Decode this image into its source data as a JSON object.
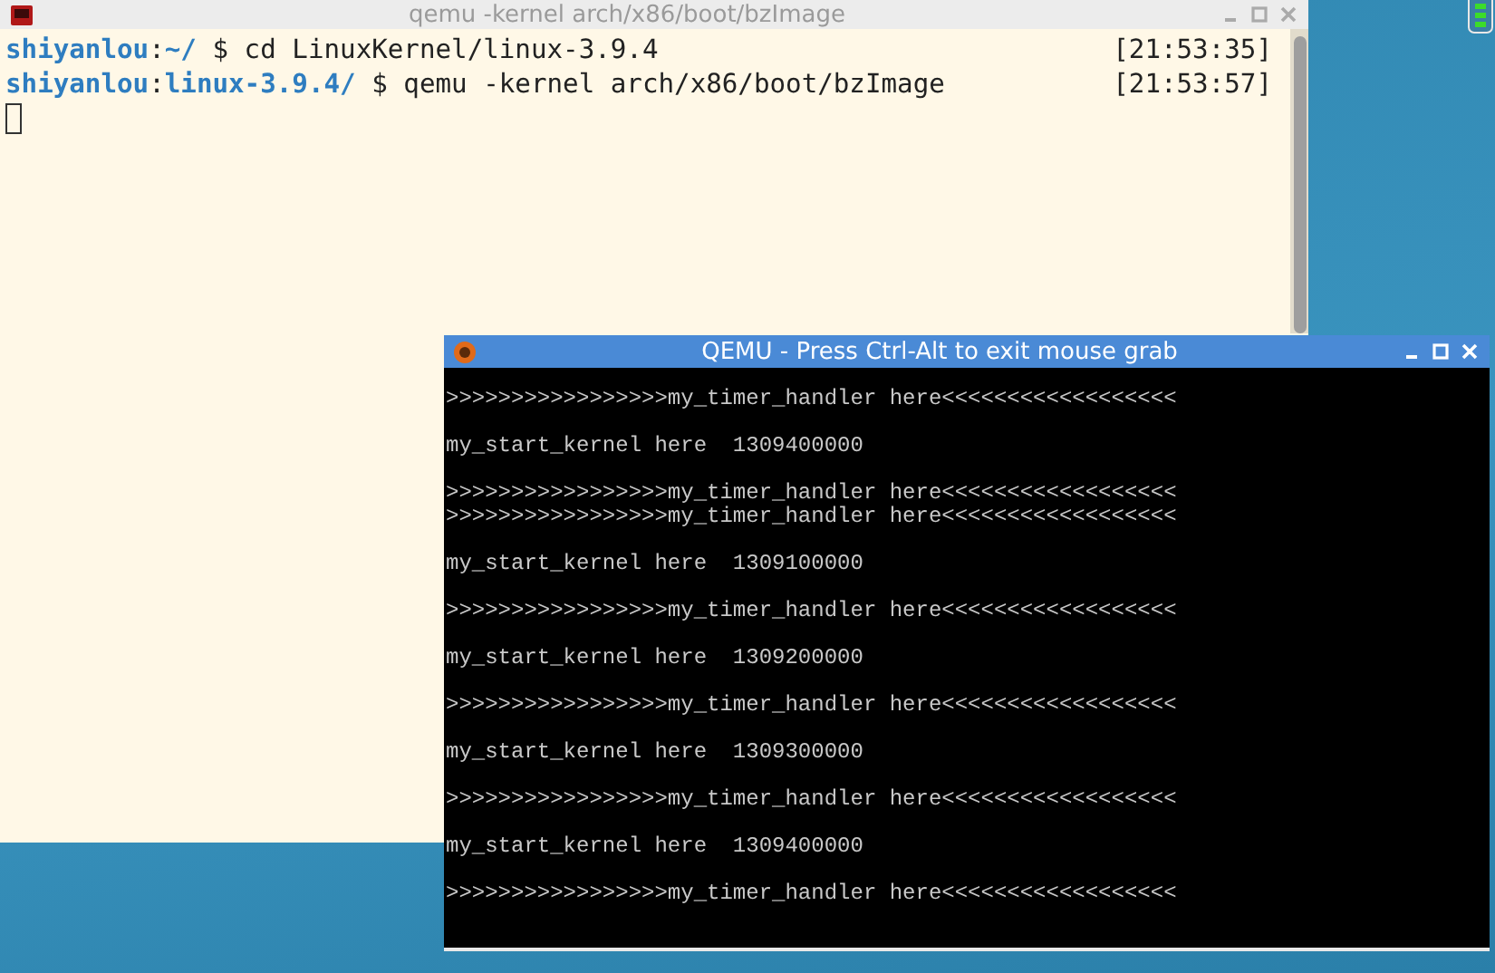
{
  "terminal": {
    "title": "qemu -kernel arch/x86/boot/bzImage",
    "lines": [
      {
        "user": "shiyanlou",
        "separator": ":",
        "path": "~/",
        "command": "$ cd LinuxKernel/linux-3.9.4",
        "time": "[21:53:35]"
      },
      {
        "user": "shiyanlou",
        "separator": ":",
        "path": "linux-3.9.4/",
        "command": "$ qemu -kernel arch/x86/boot/bzImage",
        "time": "[21:53:57]"
      }
    ]
  },
  "qemu": {
    "title": "QEMU - Press Ctrl-Alt to exit mouse grab",
    "blocks": [
      [
        ">>>>>>>>>>>>>>>>>my_timer_handler here<<<<<<<<<<<<<<<<<<"
      ],
      [
        "my_start_kernel here  1309400000"
      ],
      [
        ">>>>>>>>>>>>>>>>>my_timer_handler here<<<<<<<<<<<<<<<<<<",
        ">>>>>>>>>>>>>>>>>my_timer_handler here<<<<<<<<<<<<<<<<<<"
      ],
      [
        "my_start_kernel here  1309100000"
      ],
      [
        ">>>>>>>>>>>>>>>>>my_timer_handler here<<<<<<<<<<<<<<<<<<"
      ],
      [
        "my_start_kernel here  1309200000"
      ],
      [
        ">>>>>>>>>>>>>>>>>my_timer_handler here<<<<<<<<<<<<<<<<<<"
      ],
      [
        "my_start_kernel here  1309300000"
      ],
      [
        ">>>>>>>>>>>>>>>>>my_timer_handler here<<<<<<<<<<<<<<<<<<"
      ],
      [
        "my_start_kernel here  1309400000"
      ],
      [
        ">>>>>>>>>>>>>>>>>my_timer_handler here<<<<<<<<<<<<<<<<<<"
      ]
    ]
  }
}
